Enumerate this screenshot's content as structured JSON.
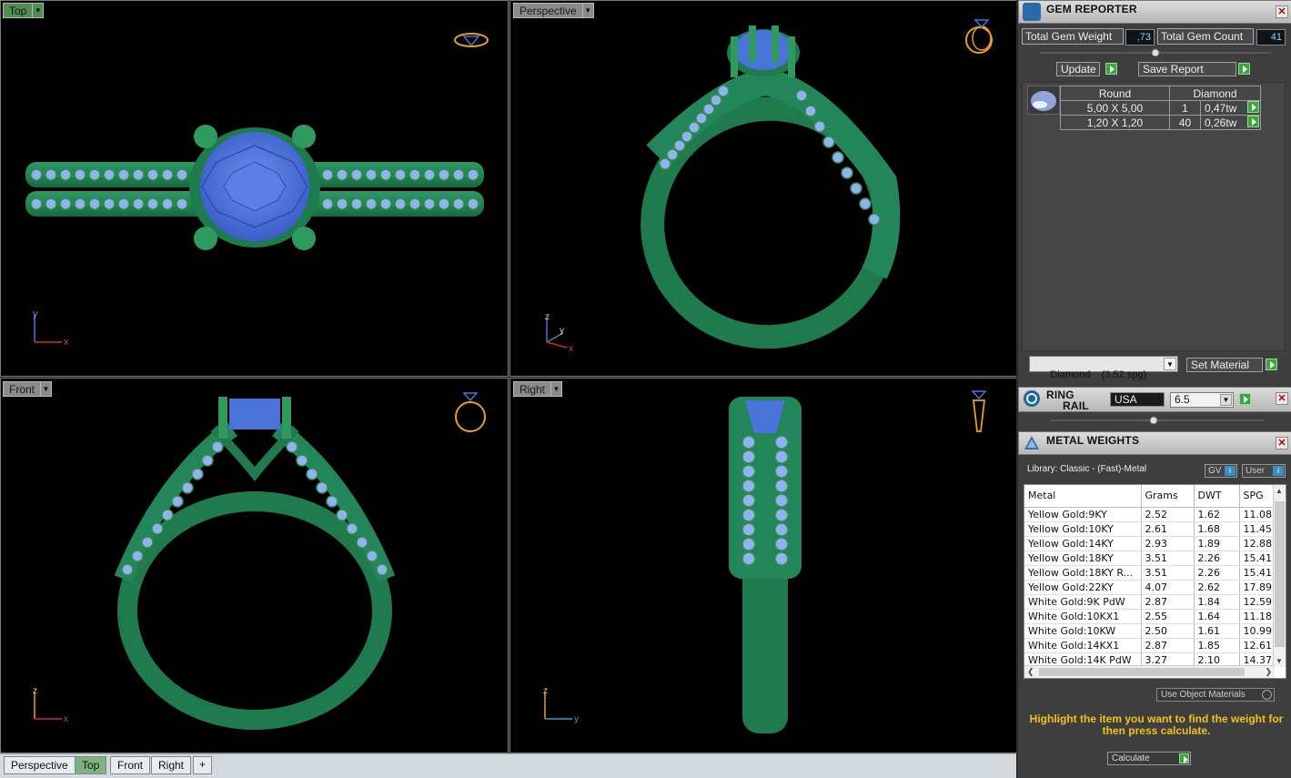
{
  "viewports": {
    "top": {
      "label": "Top"
    },
    "perspective": {
      "label": "Perspective"
    },
    "front": {
      "label": "Front"
    },
    "right": {
      "label": "Right"
    }
  },
  "axes": {
    "x": "x",
    "y": "y",
    "z": "z"
  },
  "tabs": [
    "Perspective",
    "Top",
    "Front",
    "Right",
    "+"
  ],
  "active_tab": "Top",
  "colors": {
    "metal": "#1f7a4d",
    "gem": "#4a73d9",
    "navcube": "#e8a020",
    "active_tab": "#7fb27f",
    "accent_green": "#38a83a",
    "hint": "#f2c21b"
  },
  "gem_reporter": {
    "title": "GEM REPORTER",
    "total_weight_label": "Total Gem Weight",
    "total_weight_value": ",73",
    "total_count_label": "Total Gem Count",
    "total_count_value": "41",
    "update_label": "Update",
    "save_report_label": "Save Report",
    "table_headers": [
      "Round",
      "Diamond"
    ],
    "rows": [
      {
        "size": "5,00 X 5,00",
        "count": "1",
        "weight": "0,47tw"
      },
      {
        "size": "1,20 X 1,20",
        "count": "40",
        "weight": "0,26tw"
      }
    ],
    "material_select": "Diamond    (3,52 spg)",
    "set_material_label": "Set Material"
  },
  "ring_rail": {
    "title_line1": "RING",
    "title_line2": "RAIL",
    "standard": "USA",
    "size": "6.5"
  },
  "metal_weights": {
    "title": "METAL WEIGHTS",
    "library": "Library: Classic - (Fast)-Metal",
    "gv_label": "GV",
    "user_label": "User",
    "columns": [
      "Metal",
      "Grams",
      "DWT",
      "SPG"
    ],
    "rows": [
      [
        "Yellow Gold:9KY",
        "2.52",
        "1.62",
        "11.08"
      ],
      [
        "Yellow Gold:10KY",
        "2.61",
        "1.68",
        "11.45"
      ],
      [
        "Yellow Gold:14KY",
        "2.93",
        "1.89",
        "12.88"
      ],
      [
        "Yellow Gold:18KY",
        "3.51",
        "2.26",
        "15.41"
      ],
      [
        "Yellow Gold:18KY R...",
        "3.51",
        "2.26",
        "15.41"
      ],
      [
        "Yellow Gold:22KY",
        "4.07",
        "2.62",
        "17.89"
      ],
      [
        "White Gold:9K PdW",
        "2.87",
        "1.84",
        "12.59"
      ],
      [
        "White Gold:10KX1",
        "2.55",
        "1.64",
        "11.18"
      ],
      [
        "White Gold:10KW",
        "2.50",
        "1.61",
        "10.99"
      ],
      [
        "White Gold:14KX1",
        "2.87",
        "1.85",
        "12.61"
      ],
      [
        "White Gold:14K PdW",
        "3.27",
        "2.10",
        "14.37"
      ]
    ],
    "use_object_materials": "Use Object Materials",
    "hint": "Highlight the item you want to find the weight for then press calculate.",
    "calculate_label": "Calculate"
  }
}
